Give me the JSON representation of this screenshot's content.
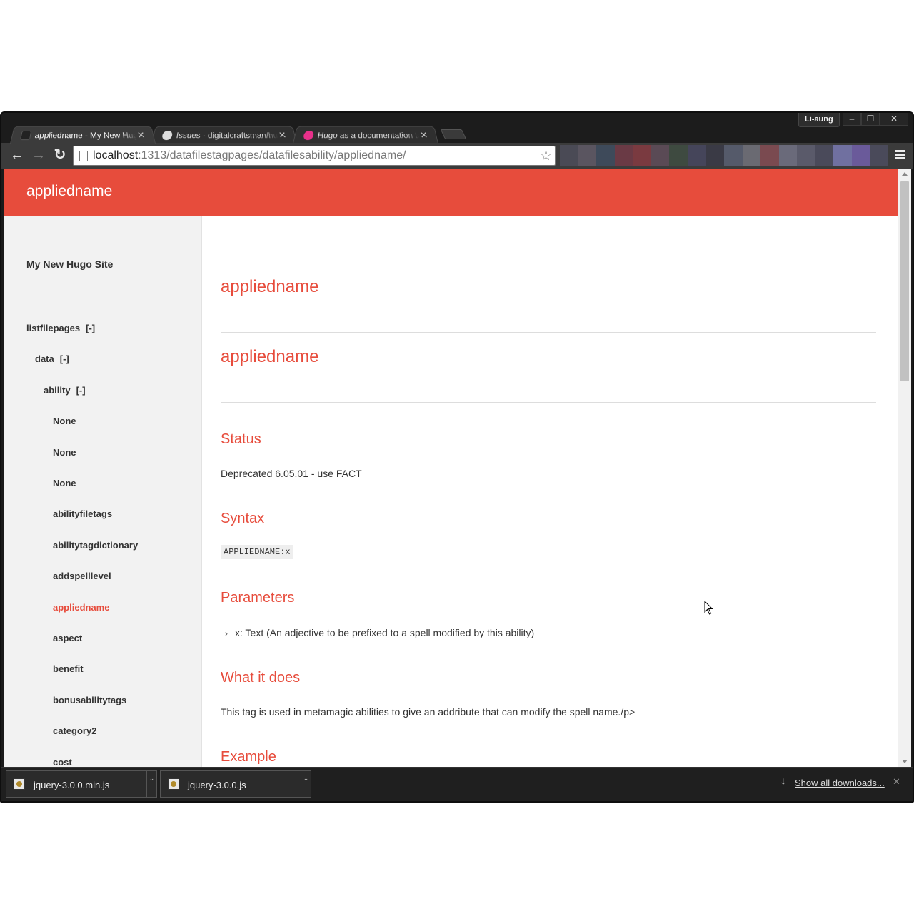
{
  "browser": {
    "user": "Li-aung",
    "window_controls": {
      "minimize": "–",
      "maximize": "☐",
      "close": "✕"
    },
    "tabs": [
      {
        "title": "appliedname - My New Hugo Site",
        "favicon_color": "#222222",
        "close": "✕",
        "active": true
      },
      {
        "title": "Issues · digitalcraftsman/hugo-material-docs",
        "favicon_color": "#ffffff",
        "close": "✕",
        "active": false
      },
      {
        "title": "Hugo as a documentation tool",
        "favicon_color": "#e8308a",
        "close": "✕",
        "active": false
      }
    ],
    "nav": {
      "back": "←",
      "forward": "→",
      "reload": "↻"
    },
    "url": {
      "host": "localhost",
      "rest": ":1313/datafilestagpages/datafilesability/appliedname/"
    },
    "star": "☆",
    "bookmark_colors": [
      "#4a4a55",
      "#5a5560",
      "#3e4a5a",
      "#6a3a45",
      "#7a3a40",
      "#5a4a55",
      "#3e4a40",
      "#45455a",
      "#3a3a45",
      "#555a6a",
      "#6a6a72",
      "#7a4a50",
      "#6a6a7a",
      "#5a5a6a",
      "#4a4a5a",
      "#7070a0",
      "#6a5a9a",
      "#4a4a5a"
    ]
  },
  "page": {
    "header_title": "appliedname",
    "site_title": "My New Hugo Site",
    "nav": [
      {
        "label": "listfilepages",
        "toggle": "[-]",
        "level": 0
      },
      {
        "label": "data",
        "toggle": "[-]",
        "level": 1
      },
      {
        "label": "ability",
        "toggle": "[-]",
        "level": 2
      },
      {
        "label": "None",
        "toggle": "",
        "level": 3
      },
      {
        "label": "None",
        "toggle": "",
        "level": 3
      },
      {
        "label": "None",
        "toggle": "",
        "level": 3
      },
      {
        "label": "abilityfiletags",
        "toggle": "",
        "level": 3
      },
      {
        "label": "abilitytagdictionary",
        "toggle": "",
        "level": 3
      },
      {
        "label": "addspelllevel",
        "toggle": "",
        "level": 3
      },
      {
        "label": "appliedname",
        "toggle": "",
        "level": 3,
        "current": true
      },
      {
        "label": "aspect",
        "toggle": "",
        "level": 3
      },
      {
        "label": "benefit",
        "toggle": "",
        "level": 3
      },
      {
        "label": "bonusabilitytags",
        "toggle": "",
        "level": 3
      },
      {
        "label": "category2",
        "toggle": "",
        "level": 3
      },
      {
        "label": "cost",
        "toggle": "",
        "level": 3
      }
    ],
    "title_1": "appliedname",
    "title_2": "appliedname",
    "status_heading": "Status",
    "status_text": "Deprecated 6.05.01 - use FACT",
    "syntax_heading": "Syntax",
    "syntax_code": "APPLIEDNAME:x",
    "parameters_heading": "Parameters",
    "parameters": [
      {
        "chevron": "›",
        "text": "x: Text (An adjective to be prefixed to a spell modified by this ability)"
      }
    ],
    "what_heading": "What it does",
    "what_text": "This tag is used in metamagic abilities to give an addribute that can modify the spell name./p>",
    "example_heading": "Example",
    "accent_color": "#e74c3c"
  },
  "downloads": {
    "items": [
      {
        "name": "jquery-3.0.0.min.js",
        "arrow": "⌄"
      },
      {
        "name": "jquery-3.0.0.js",
        "arrow": "⌄"
      }
    ],
    "show_all": "Show all downloads...",
    "download_glyph": "⤓",
    "close": "✕"
  }
}
